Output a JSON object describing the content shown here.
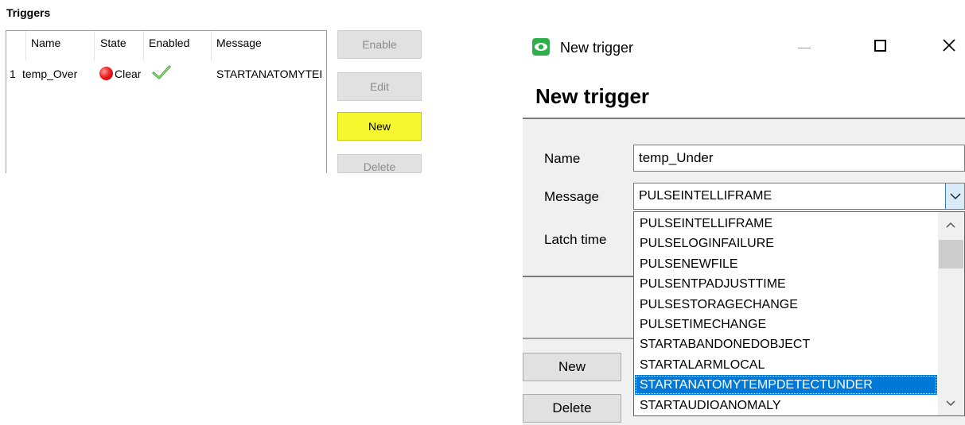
{
  "triggers_panel": {
    "title": "Triggers",
    "columns": [
      "Name",
      "State",
      "Enabled",
      "Message"
    ],
    "rows": [
      {
        "index": "1",
        "name": "temp_Over",
        "state": "Clear",
        "message": "STARTANATOMYTEI"
      }
    ],
    "buttons": {
      "enable": "Enable",
      "edit": "Edit",
      "new": "New",
      "delete": "Delete"
    },
    "highlight_color": "#f7f730"
  },
  "dialog": {
    "window_title": "New trigger",
    "heading": "New trigger",
    "fields": {
      "name_label": "Name",
      "name_value": "temp_Under",
      "message_label": "Message",
      "message_value": "PULSEINTELLIFRAME",
      "latch_label": "Latch time"
    },
    "buttons": {
      "new": "New",
      "delete": "Delete"
    },
    "dropdown": {
      "items": [
        "PULSEINTELLIFRAME",
        "PULSELOGINFAILURE",
        "PULSENEWFILE",
        "PULSENTPADJUSTTIME",
        "PULSESTORAGECHANGE",
        "PULSETIMECHANGE",
        "STARTABANDONEDOBJECT",
        "STARTALARMLOCAL",
        "STARTANATOMYTEMPDETECTUNDER",
        "STARTAUDIOANOMALY"
      ],
      "selected_index": 8,
      "selection_color": "#0078d7"
    },
    "icons": [
      "eye-app-icon",
      "minimize-icon",
      "maximize-icon",
      "close-icon",
      "chevron-down-icon",
      "scroll-up-icon",
      "scroll-down-icon"
    ]
  }
}
